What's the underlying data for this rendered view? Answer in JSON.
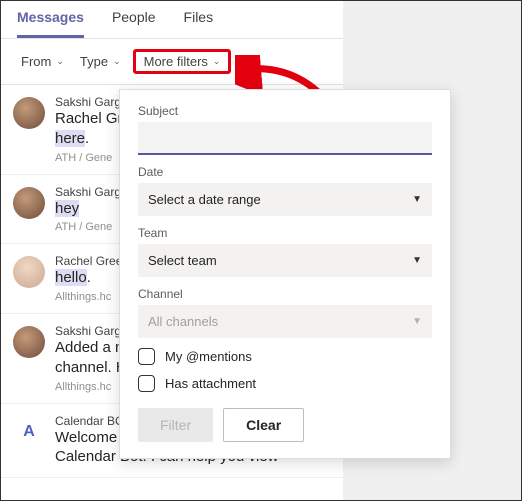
{
  "tabs": {
    "messages": "Messages",
    "people": "People",
    "files": "Files"
  },
  "filters": {
    "from": "From",
    "type": "Type",
    "more": "More filters"
  },
  "messages": [
    {
      "sender": "Sakshi Garg",
      "snippet_pre": "Rachel Gre",
      "hl": "here",
      "suffix": ".",
      "loc": "ATH / Gene"
    },
    {
      "sender": "Sakshi Garg",
      "snippet_pre": "",
      "hl": "hey",
      "suffix": "",
      "loc": "ATH / Gene"
    },
    {
      "sender": "Rachel Gree",
      "snippet_pre": "",
      "hl": "hello",
      "suffix": ".",
      "loc": "Allthings.hc"
    },
    {
      "sender": "Sakshi Garg",
      "snippet_pre": "Added a n",
      "hl": "",
      "suffix": "",
      "line2": "channel. H",
      "loc": "Allthings.hc"
    },
    {
      "sender": "Calendar BO",
      "snippet_pre": "Welcome",
      "hl": "",
      "suffix": "",
      "line2": "Calendar Bot. I can help you view",
      "loc": ""
    }
  ],
  "popover": {
    "subject": {
      "label": "Subject",
      "value": ""
    },
    "date": {
      "label": "Date",
      "placeholder": "Select a date range"
    },
    "team": {
      "label": "Team",
      "placeholder": "Select team"
    },
    "channel": {
      "label": "Channel",
      "placeholder": "All channels"
    },
    "mentions": "My @mentions",
    "attachment": "Has attachment",
    "filter_btn": "Filter",
    "clear_btn": "Clear"
  }
}
